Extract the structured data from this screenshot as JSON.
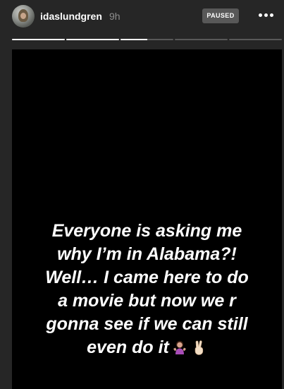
{
  "header": {
    "username": "idaslundgren",
    "time": "9h",
    "paused_badge": "PAUSED"
  },
  "progress": {
    "segments": [
      1,
      1,
      0.5,
      0,
      0
    ]
  },
  "story": {
    "caption": "Everyone is asking me\nwhy I’m in Alabama?!\nWell… I came here to do\na movie but now we r\ngonna see if we can still\neven do it",
    "emojis": [
      "person-shrugging-icon",
      "victory-hand-icon"
    ]
  },
  "icons": {
    "more": "more-options-icon",
    "avatar": "avatar"
  }
}
